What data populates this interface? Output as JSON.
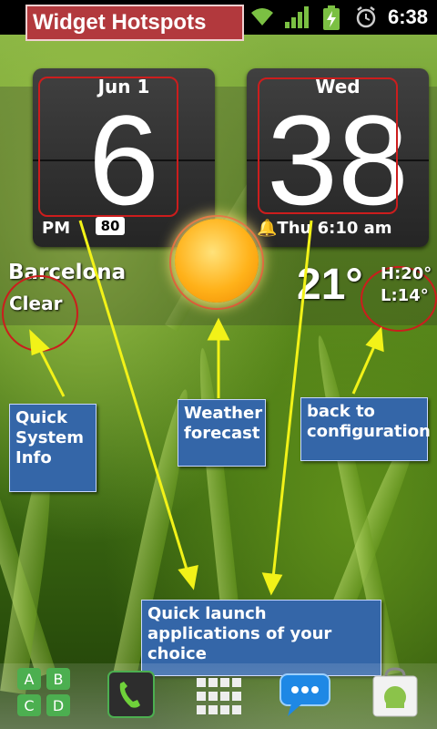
{
  "title_banner": "Widget Hotspots",
  "status_bar": {
    "time": "6:38"
  },
  "clock": {
    "date": "Jun  1",
    "hour": "6",
    "day": "Wed",
    "minute": "38",
    "ampm": "PM",
    "battery": "80",
    "alarm": "Thu 6:10 am"
  },
  "weather": {
    "city": "Barcelona",
    "condition": "Clear",
    "temp": "21°",
    "high": "H:20°",
    "low": "L:14°"
  },
  "annotations": {
    "system_info": "Quick System Info",
    "forecast": "Weather forecast",
    "config": "back to configuration",
    "launch": "Quick launch applications of your choice"
  },
  "colors": {
    "banner": "#b2393d",
    "note_bg": "#3466a8",
    "arrow": "#f2f218",
    "hotspot": "#cc1d1d"
  },
  "dock": [
    "abcd-icon",
    "phone-icon",
    "app-drawer-icon",
    "messaging-icon",
    "market-icon"
  ]
}
